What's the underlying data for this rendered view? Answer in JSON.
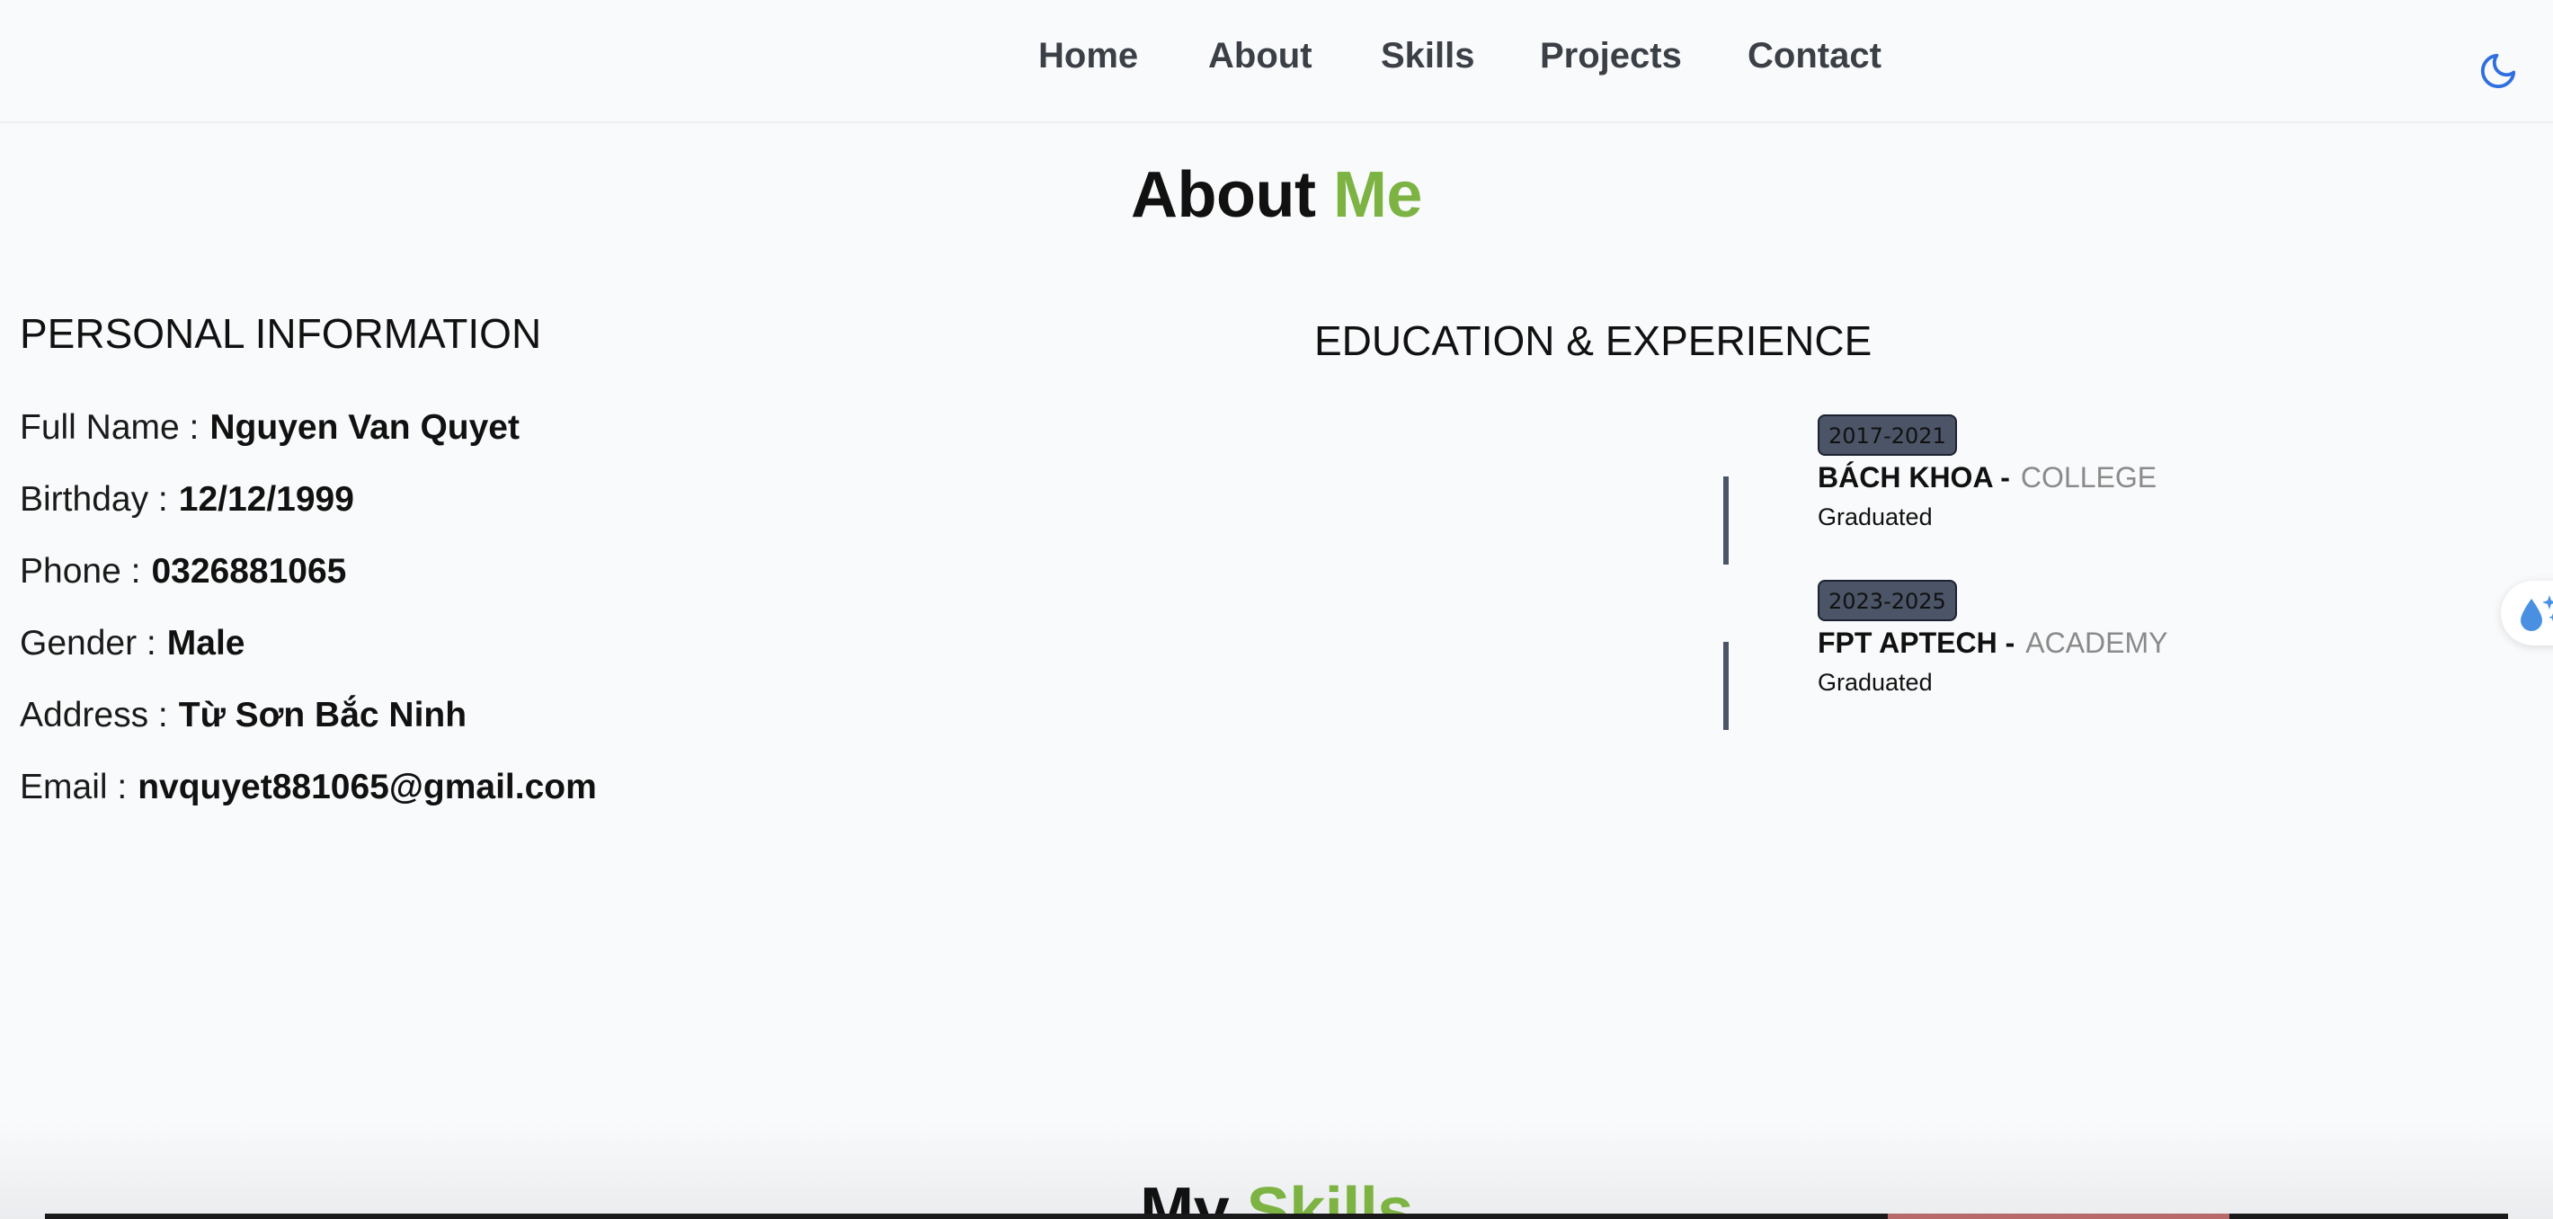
{
  "nav": {
    "items": [
      {
        "label": "Home"
      },
      {
        "label": "About"
      },
      {
        "label": "Skills"
      },
      {
        "label": "Projects"
      },
      {
        "label": "Contact"
      }
    ],
    "theme_icon": "moon-icon"
  },
  "about": {
    "title_main": "About",
    "title_accent": "Me"
  },
  "colors": {
    "accent": "#7cb342",
    "nav_text": "#3b3f46",
    "theme_icon": "#2f6fe0",
    "badge_bg": "#4b5567"
  },
  "personal": {
    "heading": "PERSONAL INFORMATION",
    "rows": [
      {
        "label": "Full Name :",
        "value": "Nguyen Van Quyet"
      },
      {
        "label": "Birthday :",
        "value": "12/12/1999"
      },
      {
        "label": "Phone :",
        "value": "0326881065"
      },
      {
        "label": "Gender :",
        "value": "Male"
      },
      {
        "label": "Address :",
        "value": "Từ Sơn Bắc Ninh"
      },
      {
        "label": "Email :",
        "value": "nvquyet881065@gmail.com"
      }
    ]
  },
  "education": {
    "heading": "EDUCATION & EXPERIENCE",
    "items": [
      {
        "years": "2017-2021",
        "school": "BÁCH KHOA -",
        "type": "COLLEGE",
        "status": "Graduated"
      },
      {
        "years": "2023-2025",
        "school": "FPT APTECH -",
        "type": "ACADEMY",
        "status": "Graduated"
      }
    ]
  },
  "floating_widget": {
    "icon": "sparkle-drop-icon"
  },
  "skills": {
    "title_main": "My",
    "title_accent": "Skills"
  }
}
